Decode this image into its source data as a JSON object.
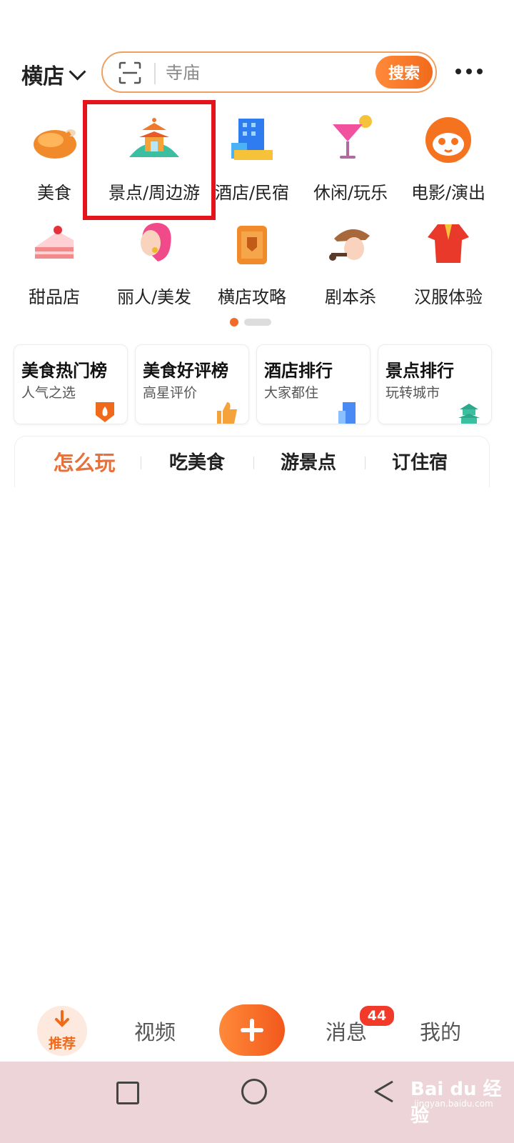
{
  "header": {
    "city": "横店",
    "search_placeholder": "寺庙",
    "search_button": "搜索"
  },
  "categories": [
    {
      "label": "美食",
      "icon": "roast-chicken-icon"
    },
    {
      "label": "景点/周边游",
      "icon": "pagoda-icon"
    },
    {
      "label": "酒店/民宿",
      "icon": "hotel-building-icon"
    },
    {
      "label": "休闲/玩乐",
      "icon": "cocktail-icon"
    },
    {
      "label": "电影/演出",
      "icon": "cat-face-icon"
    },
    {
      "label": "甜品店",
      "icon": "cake-icon"
    },
    {
      "label": "丽人/美发",
      "icon": "woman-hair-icon"
    },
    {
      "label": "横店攻略",
      "icon": "luggage-icon"
    },
    {
      "label": "剧本杀",
      "icon": "detective-icon"
    },
    {
      "label": "汉服体验",
      "icon": "hanfu-icon"
    }
  ],
  "rankings": [
    {
      "title": "美食热门榜",
      "subtitle": "人气之选",
      "icon": "fire-badge-icon"
    },
    {
      "title": "美食好评榜",
      "subtitle": "高星评价",
      "icon": "thumbs-up-icon"
    },
    {
      "title": "酒店排行",
      "subtitle": "大家都住",
      "icon": "building-icon"
    },
    {
      "title": "景点排行",
      "subtitle": "玩转城市",
      "icon": "pagoda-small-icon"
    }
  ],
  "tabs": [
    "怎么玩",
    "吃美食",
    "游景点",
    "订住宿"
  ],
  "active_tab": "怎么玩",
  "bottom_nav": {
    "recommend": "推荐",
    "video": "视频",
    "messages": "消息",
    "messages_badge": "44",
    "mine": "我的"
  },
  "watermark": {
    "brand": "Bai du 经验",
    "url": "jingyan.baidu.com"
  },
  "colors": {
    "accent": "#f26a1c",
    "highlight_box": "#e3141b",
    "system_bar": "#ecd4d8"
  }
}
